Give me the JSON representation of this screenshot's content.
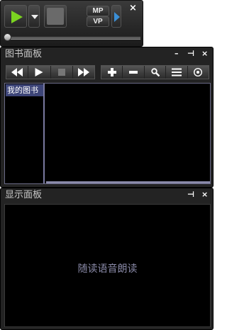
{
  "player": {
    "mp_label": "MP",
    "vp_label": "VP",
    "close_glyph": "×"
  },
  "books_panel": {
    "title": "图书面板",
    "minimize_glyph": "–",
    "pin_glyph": "⊣",
    "close_glyph": "×",
    "sidebar_item": "我的图书"
  },
  "display_panel": {
    "title": "显示面板",
    "pin_glyph": "⊣",
    "close_glyph": "×",
    "content_text": "随读语音朗读"
  },
  "colors": {
    "play_green": "#7bd321",
    "accent_blue": "#3b8fd6",
    "selected": "#3d4578"
  }
}
